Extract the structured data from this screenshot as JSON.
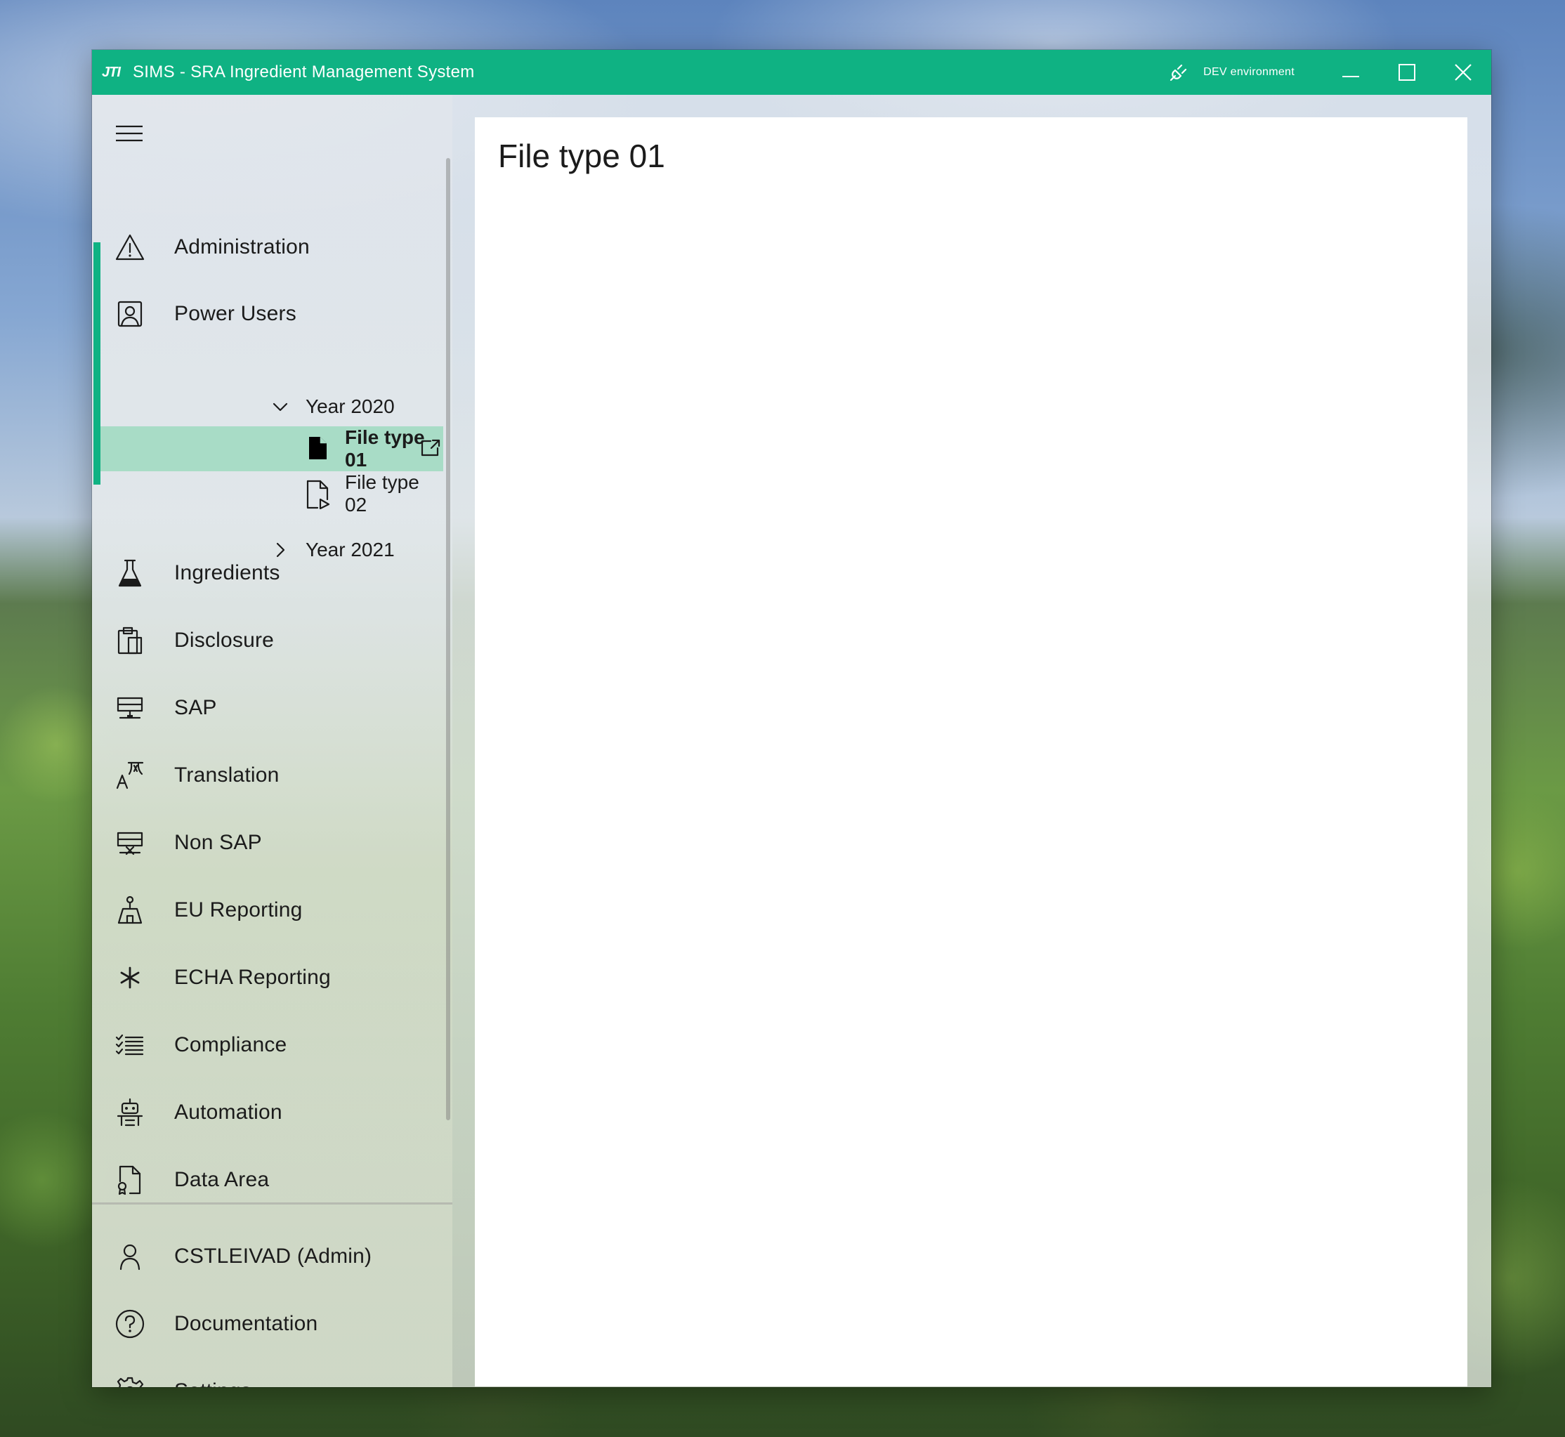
{
  "window": {
    "title": "SIMS - SRA Ingredient Management System",
    "logo_text": "JTI",
    "environment": "DEV environment",
    "accent_color": "#0fb283"
  },
  "sidebar": {
    "menu_icon": "hamburger-icon",
    "items": [
      {
        "label": "Administration",
        "icon": "warning-triangle-icon"
      },
      {
        "label": "Power Users",
        "icon": "contact-card-icon",
        "expanded": true
      },
      {
        "label": "Ingredients",
        "icon": "flask-icon"
      },
      {
        "label": "Disclosure",
        "icon": "clipboard-icon"
      },
      {
        "label": "SAP",
        "icon": "network-monitor-icon"
      },
      {
        "label": "Translation",
        "icon": "translate-icon"
      },
      {
        "label": "Non SAP",
        "icon": "network-monitor-x-icon"
      },
      {
        "label": "EU Reporting",
        "icon": "compass-icon"
      },
      {
        "label": "ECHA Reporting",
        "icon": "asterisk-icon"
      },
      {
        "label": "Compliance",
        "icon": "checklist-icon"
      },
      {
        "label": "Automation",
        "icon": "robot-icon"
      },
      {
        "label": "Data Area",
        "icon": "document-badge-icon"
      }
    ],
    "tree": {
      "year_2020": {
        "label": "Year 2020",
        "expanded": true
      },
      "file_type_01": {
        "label": "File type 01",
        "selected": true
      },
      "file_type_02": {
        "label": "File type 02"
      },
      "year_2021": {
        "label": "Year 2021",
        "expanded": false
      }
    },
    "footer": [
      {
        "label": "CSTLEIVAD (Admin)",
        "icon": "person-icon"
      },
      {
        "label": "Documentation",
        "icon": "help-circle-icon"
      },
      {
        "label": "Settings",
        "icon": "gear-icon"
      }
    ]
  },
  "content": {
    "title": "File type 01"
  }
}
